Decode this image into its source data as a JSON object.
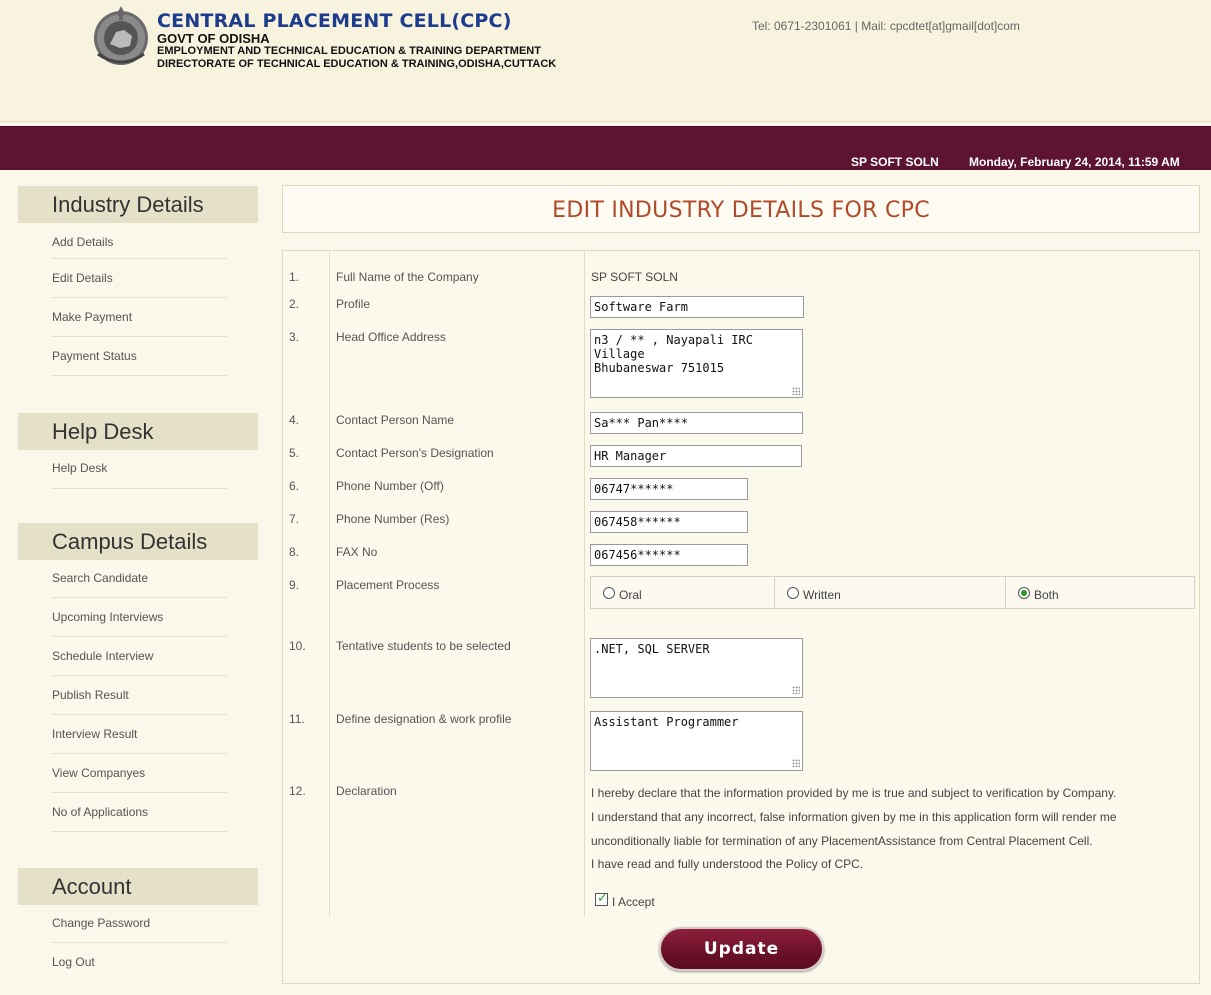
{
  "header": {
    "title": "CENTRAL PLACEMENT CELL(CPC)",
    "govt": "GOVT OF ODISHA",
    "department": "EMPLOYMENT AND TECHNICAL EDUCATION & TRAINING DEPARTMENT",
    "directorate": "DIRECTORATE OF TECHNICAL EDUCATION & TRAINING,ODISHA,CUTTACK",
    "contact": "Tel: 0671-2301061 | Mail: cpcdtet[at]gmail[dot]com",
    "logo_icon": "emblem-icon"
  },
  "topbar": {
    "company": "SP SOFT SOLN",
    "datetime": "Monday, February 24, 2014, 11:59 AM"
  },
  "sidebar": {
    "industry": {
      "heading": "Industry Details",
      "items": [
        "Add Details",
        "Edit Details",
        "Make Payment",
        "Payment Status"
      ]
    },
    "help": {
      "heading": "Help Desk",
      "items": [
        "Help Desk"
      ]
    },
    "campus": {
      "heading": "Campus Details",
      "items": [
        "Search Candidate",
        "Upcoming Interviews",
        "Schedule Interview",
        "Publish Result",
        "Interview Result",
        "View Companyes",
        "No of Applications"
      ]
    },
    "account": {
      "heading": "Account",
      "items": [
        "Change Password",
        "Log Out"
      ]
    }
  },
  "form": {
    "title": "EDIT INDUSTRY DETAILS FOR CPC",
    "rows": [
      {
        "num": "1.",
        "label": "Full Name of the Company"
      },
      {
        "num": "2.",
        "label": "Profile"
      },
      {
        "num": "3.",
        "label": "Head Office Address"
      },
      {
        "num": "4.",
        "label": "Contact Person Name"
      },
      {
        "num": "5.",
        "label": "Contact Person's Designation"
      },
      {
        "num": "6.",
        "label": "Phone Number (Off)"
      },
      {
        "num": "7.",
        "label": "Phone Number (Res)"
      },
      {
        "num": "8.",
        "label": "FAX No"
      },
      {
        "num": "9.",
        "label": "Placement Process"
      },
      {
        "num": "10.",
        "label": "Tentative students to be selected"
      },
      {
        "num": "11.",
        "label": "Define designation & work profile"
      },
      {
        "num": "12.",
        "label": "Declaration"
      }
    ],
    "company_name": "SP SOFT SOLN",
    "profile": "Software Farm",
    "address": "n3 / ** , Nayapali IRC Village\nBhubaneswar 751015",
    "contact_name": "Sa*** Pan****",
    "designation": "HR Manager",
    "phone_off": "06747******",
    "phone_res": "067458******",
    "fax": "067456******",
    "placement_options": [
      "Oral",
      "Written",
      "Both"
    ],
    "placement_selected": "Both",
    "tentative_students": ".NET, SQL SERVER",
    "work_profile": "Assistant Programmer",
    "declaration": [
      "I hereby declare that the information provided by me is true and subject to verification by Company.",
      "I understand that any incorrect, false information given by me in this application form will render me",
      "unconditionally liable for termination of any PlacementAssistance from Central Placement Cell.",
      "I have read and fully understood the Policy of CPC."
    ],
    "accept_label": "I Accept",
    "accept_checked": true,
    "update_label": "Update"
  }
}
